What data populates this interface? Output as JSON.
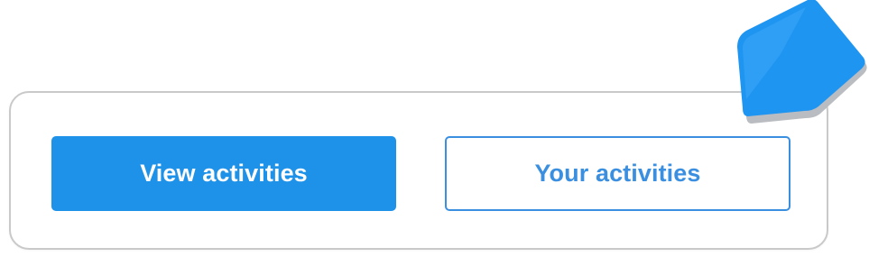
{
  "actions": {
    "view_label": "View activities",
    "yours_label": "Your activities"
  },
  "colors": {
    "primary": "#1e91e8",
    "outline": "#3a8fe0",
    "border": "#c9c9c9",
    "pointer": "#2196f3"
  },
  "icons": {
    "cursor": "pointer-arrow-icon"
  }
}
